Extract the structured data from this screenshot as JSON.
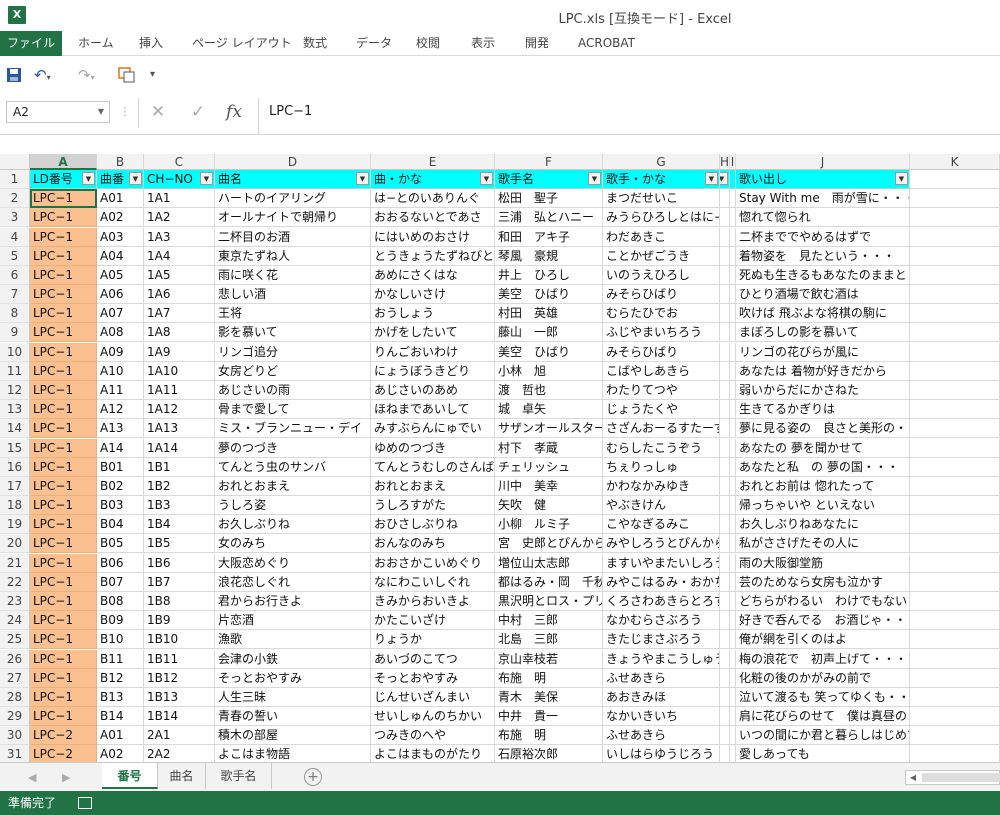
{
  "window": {
    "title": "LPC.xls  [互換モード] - Excel",
    "app_icon": "X",
    "accent": "#217346"
  },
  "ribbon": {
    "file": "ファイル",
    "tabs": [
      "ホーム",
      "挿入",
      "ページ レイアウト",
      "数式",
      "データ",
      "校閲",
      "表示",
      "開発",
      "ACROBAT"
    ]
  },
  "qat": {
    "save_icon": "save-icon",
    "undo_icon": "undo-icon",
    "redo_icon": "redo-icon",
    "touch_icon": "touch-mode-icon",
    "more_icon": "customize-icon"
  },
  "formula": {
    "namebox": "A2",
    "value": "LPC−1",
    "fx": "fx"
  },
  "columns": [
    "A",
    "B",
    "C",
    "D",
    "E",
    "F",
    "G",
    "H",
    "I",
    "J",
    "K"
  ],
  "header_row": [
    "LD番号",
    "曲番",
    "CH−NO",
    "曲名",
    "曲・かな",
    "歌手名",
    "歌手・かな",
    "",
    "",
    "歌い出し",
    ""
  ],
  "header_fill": "#00ffff",
  "col_a_fill": "#fac090",
  "rows": [
    [
      "2",
      "LPC−1",
      "A01",
      "1A1",
      "ハートのイアリング",
      "は−とのいありんぐ",
      "松田　聖子",
      "まつだせいこ",
      "Stay With me　雨が雪に・・・"
    ],
    [
      "3",
      "LPC−1",
      "A02",
      "1A2",
      "オールナイトで朝帰り",
      "おおるないとであさ",
      "三浦　弘とハニー",
      "みうらひろしとはに−",
      "惚れて惚られ"
    ],
    [
      "4",
      "LPC−1",
      "A03",
      "1A3",
      "二杯目のお酒",
      "にはいめのおさけ",
      "和田　アキ子",
      "わだあきこ",
      "二杯まででやめるはずで"
    ],
    [
      "5",
      "LPC−1",
      "A04",
      "1A4",
      "東京たずね人",
      "とうきょうたずねびと",
      "琴風　豪規",
      "ことかぜごうき",
      "着物姿を　見たという・・・"
    ],
    [
      "6",
      "LPC−1",
      "A05",
      "1A5",
      "雨に咲く花",
      "あめにさくはな",
      "井上　ひろし",
      "いのうえひろし",
      "死ぬも生きるもあなたのままと"
    ],
    [
      "7",
      "LPC−1",
      "A06",
      "1A6",
      "悲しい酒",
      "かなしいさけ",
      "美空　ひばり",
      "みそらひばり",
      "ひとり酒場で飲む酒は"
    ],
    [
      "8",
      "LPC−1",
      "A07",
      "1A7",
      "王将",
      "おうしょう",
      "村田　英雄",
      "むらたひでお",
      "吹けば 飛ぶよな将棋の駒に"
    ],
    [
      "9",
      "LPC−1",
      "A08",
      "1A8",
      "影を慕いて",
      "かげをしたいて",
      "藤山　一郎",
      "ふじやまいちろう",
      "まぼろしの影を慕いて"
    ],
    [
      "10",
      "LPC−1",
      "A09",
      "1A9",
      "リンゴ追分",
      "りんごおいわけ",
      "美空　ひばり",
      "みそらひばり",
      "リンゴの花びらが風に"
    ],
    [
      "11",
      "LPC−1",
      "A10",
      "1A10",
      "女房どりど",
      "にょうぼうきどり",
      "小林　旭",
      "こばやしあきら",
      "あなたは 着物が好きだから"
    ],
    [
      "12",
      "LPC−1",
      "A11",
      "1A11",
      "あじさいの雨",
      "あじさいのあめ",
      "渡　哲也",
      "わたりてつや",
      "弱いからだにかさねた"
    ],
    [
      "13",
      "LPC−1",
      "A12",
      "1A12",
      "骨まで愛して",
      "ほねまであいして",
      "城　卓矢",
      "じょうたくや",
      "生きてるかぎりは"
    ],
    [
      "14",
      "LPC−1",
      "A13",
      "1A13",
      "ミス・ブランニュー・デイ",
      "みすぶらんにゅでい",
      "サザンオールスターズ",
      "さざんおーるすたーず",
      "夢に見る姿の　良さと美形の・・・"
    ],
    [
      "15",
      "LPC−1",
      "A14",
      "1A14",
      "夢のつづき",
      "ゆめのつづき",
      "村下　孝蔵",
      "むらしたこうぞう",
      "あなたの 夢を聞かせて"
    ],
    [
      "16",
      "LPC−1",
      "B01",
      "1B1",
      "てんとう虫のサンバ",
      "てんとうむしのさんば",
      "チェリッシュ",
      "ちぇりっしゅ",
      "あなたと私　の 夢の国・・・"
    ],
    [
      "17",
      "LPC−1",
      "B02",
      "1B2",
      "おれとおまえ",
      "おれとおまえ",
      "川中　美幸",
      "かわなかみゆき",
      "おれとお前は 惚れたって"
    ],
    [
      "18",
      "LPC−1",
      "B03",
      "1B3",
      "うしろ姿",
      "うしろすがた",
      "矢吹　健",
      "やぶきけん",
      "帰っちゃいや といえない"
    ],
    [
      "19",
      "LPC−1",
      "B04",
      "1B4",
      "お久しぶりね",
      "おひさしぶりね",
      "小柳　ルミ子",
      "こやなぎるみこ",
      "お久しぶりねあなたに"
    ],
    [
      "20",
      "LPC−1",
      "B05",
      "1B5",
      "女のみち",
      "おんなのみち",
      "宮　史郎とぴんからトリオ",
      "みやしろうとぴんからとりお",
      "私がささげたその人に"
    ],
    [
      "21",
      "LPC−1",
      "B06",
      "1B6",
      "大阪恋めぐり",
      "おおさかこいめぐり",
      "増位山太志郎",
      "ますいやまたいしろう",
      "雨の大阪御堂筋"
    ],
    [
      "22",
      "LPC−1",
      "B07",
      "1B7",
      "浪花恋しぐれ",
      "なにわこいしぐれ",
      "都はるみ・岡　千秋",
      "みやこはるみ・おかちあき",
      "芸のためなら女房も泣かす"
    ],
    [
      "23",
      "LPC−1",
      "B08",
      "1B8",
      "君からお行きよ",
      "きみからおいきよ",
      "黒沢明とロス・プリモス",
      "くろさわあきらとろすぷりもす",
      "どちらがわるい　わけでもないさ・・・"
    ],
    [
      "24",
      "LPC−1",
      "B09",
      "1B9",
      "片恋酒",
      "かたこいざけ",
      "中村　三郎",
      "なかむらさぶろう",
      "好きで呑んでる　お酒じゃ・・・"
    ],
    [
      "25",
      "LPC−1",
      "B10",
      "1B10",
      "漁歌",
      "りょうか",
      "北島　三郎",
      "きたじまさぶろう",
      "俺が網を引くのはよ"
    ],
    [
      "26",
      "LPC−1",
      "B11",
      "1B11",
      "会津の小鉄",
      "あいづのこてつ",
      "京山幸枝若",
      "きょうやまこうしゅうじゃく",
      "梅の浪花で　初声上げて・・・"
    ],
    [
      "27",
      "LPC−1",
      "B12",
      "1B12",
      "そっとおやすみ",
      "そっとおやすみ",
      "布施　明",
      "ふせあきら",
      "化粧の後のかがみの前で"
    ],
    [
      "28",
      "LPC−1",
      "B13",
      "1B13",
      "人生三昧",
      "じんせいざんまい",
      "青木　美保",
      "あおきみほ",
      "泣いて渡るも 笑ってゆくも・・・"
    ],
    [
      "29",
      "LPC−1",
      "B14",
      "1B14",
      "青春の誓い",
      "せいしゅんのちかい",
      "中井　貴一",
      "なかいきいち",
      "肩に花びらのせて　僕は真昼の"
    ],
    [
      "30",
      "LPC−2",
      "A01",
      "2A1",
      "積木の部屋",
      "つみきのへや",
      "布施　明",
      "ふせあきら",
      "いつの間にか君と暮らしはじめて"
    ],
    [
      "31",
      "LPC−2",
      "A02",
      "2A2",
      "よこはま物語",
      "よこはまものがたり",
      "石原裕次郎",
      "いしはらゆうじろう",
      "愛しあっても"
    ],
    [
      "32",
      "LPC−2",
      "A03",
      "2A3",
      "酒と泪と男と女",
      "さけとなみだとおとこと",
      "河島　英五",
      "かわしまえいご",
      "忘れてしまいたい事や"
    ]
  ],
  "sheets": [
    "番号",
    "曲名",
    "歌手名"
  ],
  "status": {
    "text": "準備完了"
  }
}
